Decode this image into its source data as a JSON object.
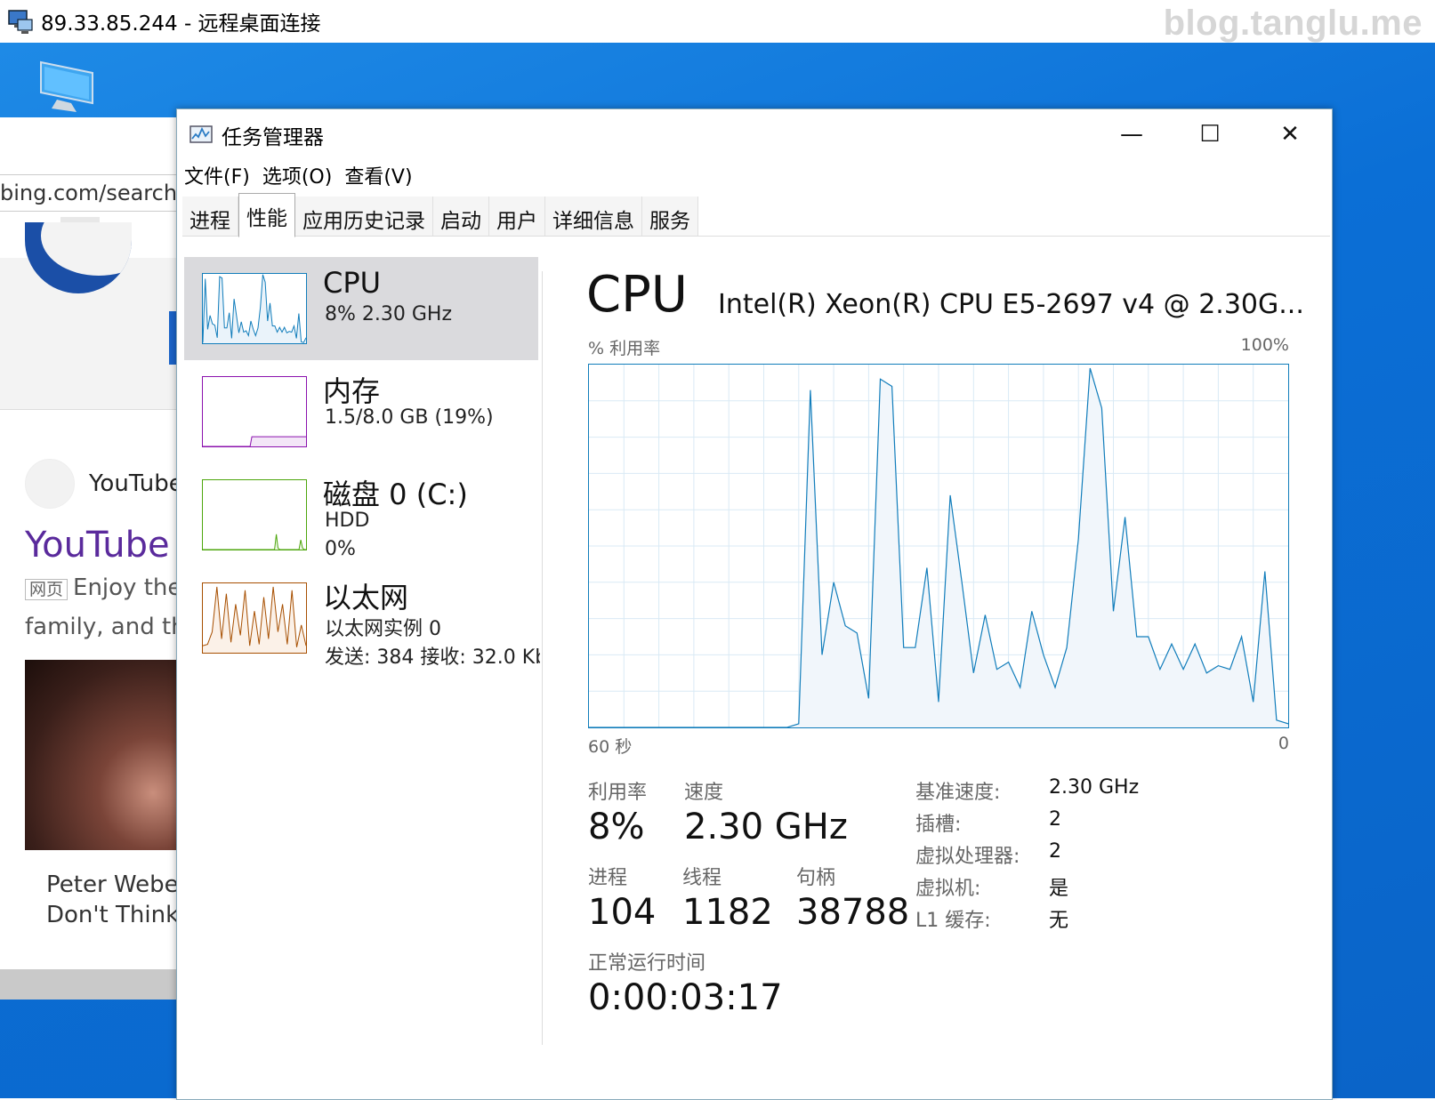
{
  "rdp": {
    "title": "89.33.85.244 - 远程桌面连接",
    "watermark": "blog.tanglu.me"
  },
  "browser": {
    "address": "bing.com/search?q",
    "tab_close": "×",
    "result_source": "YouTube",
    "result_title": "YouTube",
    "snippet_tag": "网页",
    "snippet_line1": "Enjoy the",
    "snippet_line2": "family, and the",
    "caption_line1": "Peter Weber",
    "caption_line2": "Don't Think"
  },
  "taskmgr": {
    "title": "任务管理器",
    "window_buttons": {
      "minimize": "—",
      "maximize": "☐",
      "close": "✕"
    },
    "menu": [
      "文件(F)",
      "选项(O)",
      "查看(V)"
    ],
    "tabs": [
      "进程",
      "性能",
      "应用历史记录",
      "启动",
      "用户",
      "详细信息",
      "服务"
    ],
    "active_tab": "性能",
    "sidebar": [
      {
        "name": "CPU",
        "line1": "8%  2.30 GHz",
        "line2": "",
        "color": "#117dbb",
        "selected": true
      },
      {
        "name": "内存",
        "line1": "1.5/8.0 GB (19%)",
        "line2": "",
        "color": "#8b12ae",
        "selected": false
      },
      {
        "name": "磁盘 0 (C:)",
        "line1": "HDD",
        "line2": "0%",
        "color": "#4da60c",
        "selected": false
      },
      {
        "name": "以太网",
        "line1": "以太网实例 0",
        "line2": "发送: 384  接收: 32.0 Kb",
        "color": "#a74f01",
        "selected": false
      }
    ],
    "cpu": {
      "heading": "CPU",
      "model": "Intel(R) Xeon(R) CPU E5-2697 v4 @ 2.30G...",
      "util_label": "% 利用率",
      "max_label": "100%",
      "time_left": "60 秒",
      "time_right": "0",
      "accent": "#117dbb",
      "history_percent": [
        0,
        0,
        0,
        0,
        0,
        0,
        0,
        0,
        0,
        0,
        0,
        0,
        0,
        0,
        0,
        0,
        0,
        0,
        1,
        93,
        20,
        40,
        28,
        26,
        8,
        96,
        94,
        22,
        22,
        44,
        7,
        64,
        40,
        15,
        31,
        16,
        18,
        11,
        32,
        20,
        11,
        22,
        52,
        99,
        88,
        32,
        58,
        25,
        25,
        16,
        23,
        16,
        23,
        15,
        17,
        16,
        25,
        7,
        43,
        2,
        1
      ],
      "stats": {
        "util_label": "利用率",
        "util": "8%",
        "speed_label": "速度",
        "speed": "2.30 GHz",
        "proc_label": "进程",
        "proc": "104",
        "thread_label": "线程",
        "thread": "1182",
        "handle_label": "句柄",
        "handle": "38788",
        "uptime_label": "正常运行时间",
        "uptime": "0:00:03:17"
      },
      "details": [
        {
          "k": "基准速度:",
          "v": "2.30 GHz"
        },
        {
          "k": "插槽:",
          "v": "2"
        },
        {
          "k": "虚拟处理器:",
          "v": "2"
        },
        {
          "k": "虚拟机:",
          "v": "是"
        },
        {
          "k": "L1 缓存:",
          "v": "无"
        }
      ]
    }
  }
}
